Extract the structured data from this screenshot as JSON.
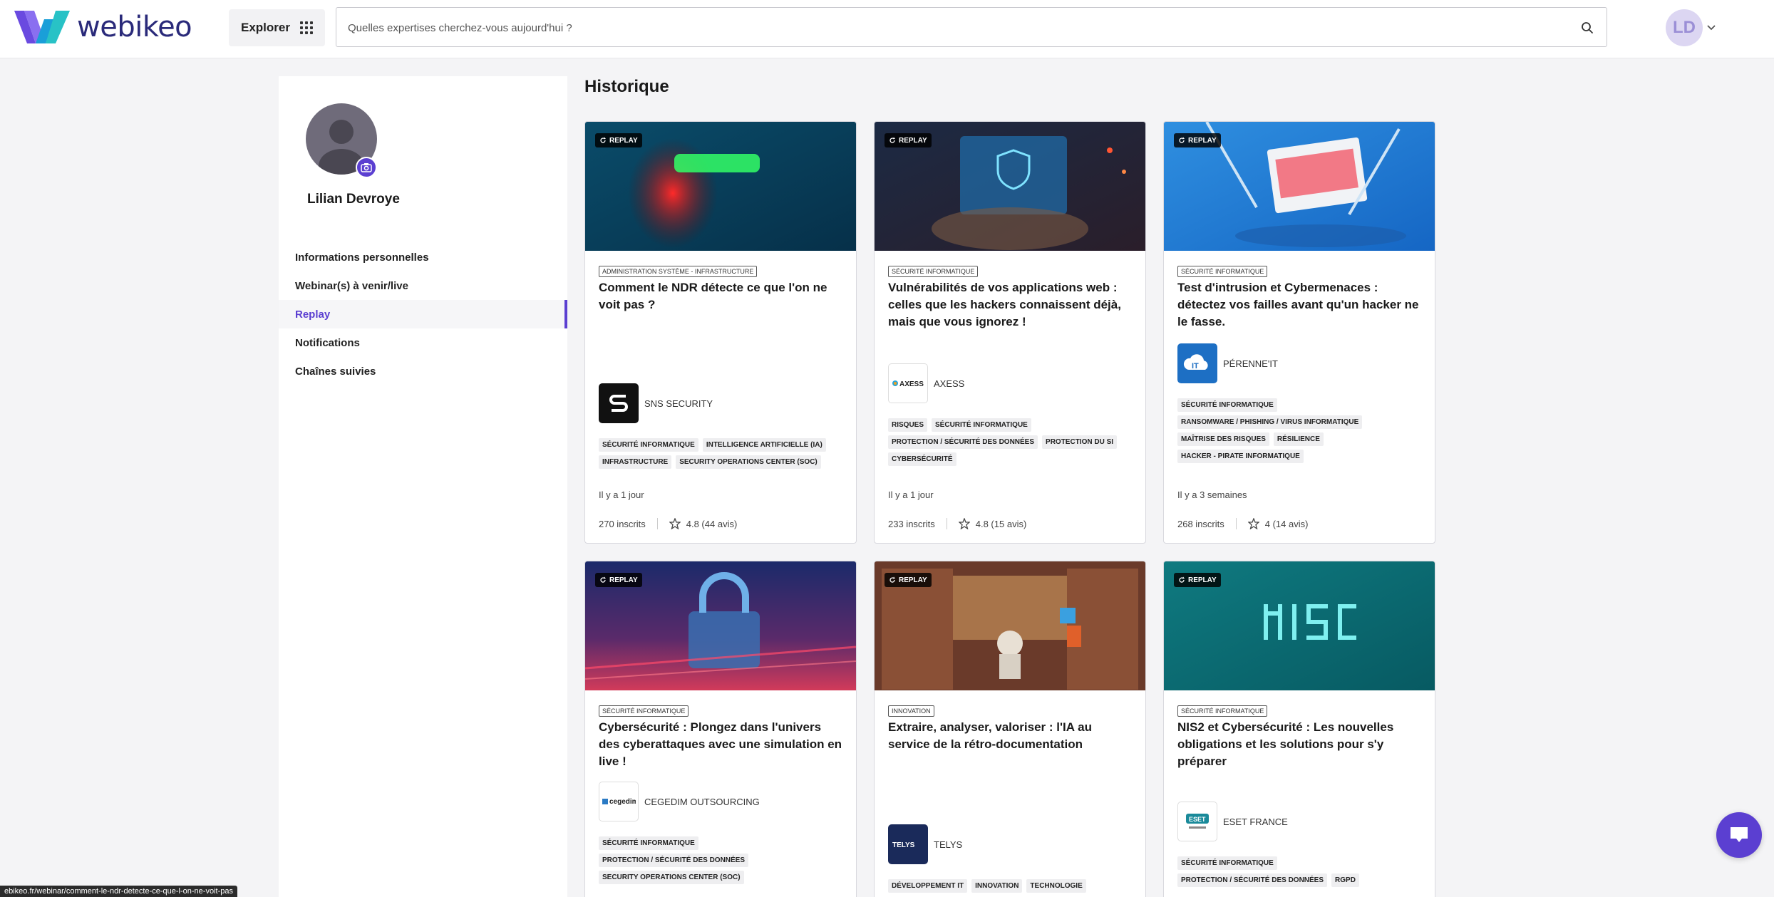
{
  "header": {
    "logo_text": "webikeo",
    "explorer_label": "Explorer",
    "search_placeholder": "Quelles expertises cherchez-vous aujourd'hui ?",
    "avatar_initials": "LD"
  },
  "sidebar": {
    "profile_name": "Lilian Devroye",
    "items": [
      {
        "label": "Informations personnelles",
        "active": false
      },
      {
        "label": "Webinar(s) à venir/live",
        "active": false
      },
      {
        "label": "Replay",
        "active": true
      },
      {
        "label": "Notifications",
        "active": false
      },
      {
        "label": "Chaînes suivies",
        "active": false
      }
    ]
  },
  "main": {
    "title": "Historique",
    "replay_label": "REPLAY",
    "cards": [
      {
        "category": "ADMINISTRATION SYSTÈME - INFRASTRUCTURE",
        "title": "Comment le NDR détecte ce que l'on ne voit pas ?",
        "org": "SNS SECURITY",
        "tags": [
          "SÉCURITÉ INFORMATIQUE",
          "INTELLIGENCE ARTIFICIELLE (IA)",
          "INFRASTRUCTURE",
          "SECURITY OPERATIONS CENTER (SOC)"
        ],
        "time": "Il y a 1 jour",
        "registrants": "270 inscrits",
        "rating": "4.8 (44 avis)"
      },
      {
        "category": "SÉCURITÉ INFORMATIQUE",
        "title": "Vulnérabilités de vos applications web : celles que les hackers connaissent déjà, mais que vous ignorez !",
        "org": "AXESS",
        "tags": [
          "RISQUES",
          "SÉCURITÉ INFORMATIQUE",
          "PROTECTION / SÉCURITÉ DES DONNÉES",
          "PROTECTION DU SI",
          "CYBERSÉCURITÉ"
        ],
        "time": "Il y a 1 jour",
        "registrants": "233 inscrits",
        "rating": "4.8 (15 avis)"
      },
      {
        "category": "SÉCURITÉ INFORMATIQUE",
        "title": "Test d'intrusion et Cybermenaces : détectez vos failles avant qu'un hacker ne le fasse.",
        "org": "PÉRENNE'IT",
        "tags": [
          "SÉCURITÉ INFORMATIQUE",
          "RANSOMWARE / PHISHING / VIRUS INFORMATIQUE",
          "MAÎTRISE DES RISQUES",
          "RÉSILIENCE",
          "HACKER - PIRATE INFORMATIQUE"
        ],
        "time": "Il y a 3 semaines",
        "registrants": "268 inscrits",
        "rating": "4 (14 avis)"
      },
      {
        "category": "SÉCURITÉ INFORMATIQUE",
        "title": "Cybersécurité : Plongez dans l'univers des cyberattaques avec une simulation en live !",
        "org": "CEGEDIM OUTSOURCING",
        "tags": [
          "SÉCURITÉ INFORMATIQUE",
          "PROTECTION / SÉCURITÉ DES DONNÉES",
          "SECURITY OPERATIONS CENTER (SOC)"
        ]
      },
      {
        "category": "INNOVATION",
        "title": "Extraire, analyser, valoriser : l'IA au service de la rétro-documentation",
        "org": "TELYS",
        "tags": [
          "DÉVELOPPEMENT IT",
          "INNOVATION",
          "TECHNOLOGIE"
        ]
      },
      {
        "category": "SÉCURITÉ INFORMATIQUE",
        "title": "NIS2 et Cybersécurité : Les nouvelles obligations et les solutions pour s'y préparer",
        "org": "ESET FRANCE",
        "tags": [
          "SÉCURITÉ INFORMATIQUE",
          "PROTECTION / SÉCURITÉ DES DONNÉES",
          "RGPD"
        ]
      }
    ]
  },
  "status_bar": {
    "url": "ebikeo.fr/webinar/comment-le-ndr-detecte-ce-que-l-on-ne-voit-pas"
  },
  "colors": {
    "accent": "#5b3fd1",
    "logo": "#2a2a7a"
  }
}
